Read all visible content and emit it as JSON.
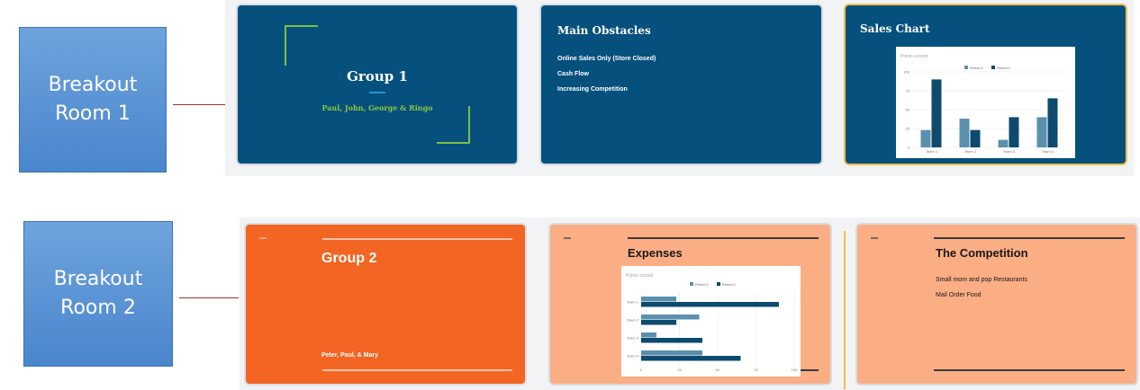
{
  "rooms": [
    {
      "line1": "Breakout",
      "line2": "Room 1"
    },
    {
      "line1": "Breakout",
      "line2": "Room 2"
    }
  ],
  "colors": {
    "room_box": "#5b95d6",
    "connector": "#a0302c",
    "blue_slide": "#05507d",
    "accent_green": "#7fbf3f",
    "selected_border": "#f3c04c",
    "orange_slide": "#f26522",
    "peach_slide": "#fbad84",
    "bar_light": "#5b8fae",
    "bar_dark": "#0d4a6e"
  },
  "group1": {
    "slide1": {
      "title": "Group 1",
      "subtitle": "Paul, John, George & Ringo"
    },
    "slide2": {
      "title": "Main Obstacles",
      "bullets": [
        "Online Sales Only (Store Closed)",
        "Cash Flow",
        "Increasing Competition"
      ]
    },
    "slide3": {
      "title": "Sales Chart",
      "selected": true
    }
  },
  "group2": {
    "slide1": {
      "title": "Group 2",
      "subtitle": "Peter, Paul, & Mary"
    },
    "slide2": {
      "title": "Expenses"
    },
    "slide3": {
      "title": "The Competition",
      "bullets": [
        "Small mom and pop Restaurants",
        "Mail Order Food"
      ]
    }
  },
  "chart_data": [
    {
      "type": "bar",
      "title": "Points scored",
      "categories": [
        "Team 1",
        "Team 2",
        "Team 3",
        "Team 4"
      ],
      "series": [
        {
          "name": "Period 1",
          "values": [
            23,
            38,
            10,
            40
          ]
        },
        {
          "name": "Period 2",
          "values": [
            90,
            23,
            40,
            65
          ]
        }
      ],
      "ylim": [
        0,
        100
      ],
      "yticks": [
        "0",
        "25",
        "50",
        "75",
        "100"
      ],
      "legend": "top"
    },
    {
      "type": "bar",
      "orientation": "horizontal",
      "title": "Points scored",
      "categories": [
        "Team 1",
        "Team 2",
        "Team 3",
        "Team 4"
      ],
      "series": [
        {
          "name": "Period 1",
          "values": [
            23,
            38,
            10,
            40
          ]
        },
        {
          "name": "Period 2",
          "values": [
            90,
            23,
            40,
            65
          ]
        }
      ],
      "xlim": [
        0,
        100
      ],
      "xticks": [
        "0",
        "25",
        "50",
        "75",
        "100"
      ],
      "legend": "top"
    }
  ]
}
